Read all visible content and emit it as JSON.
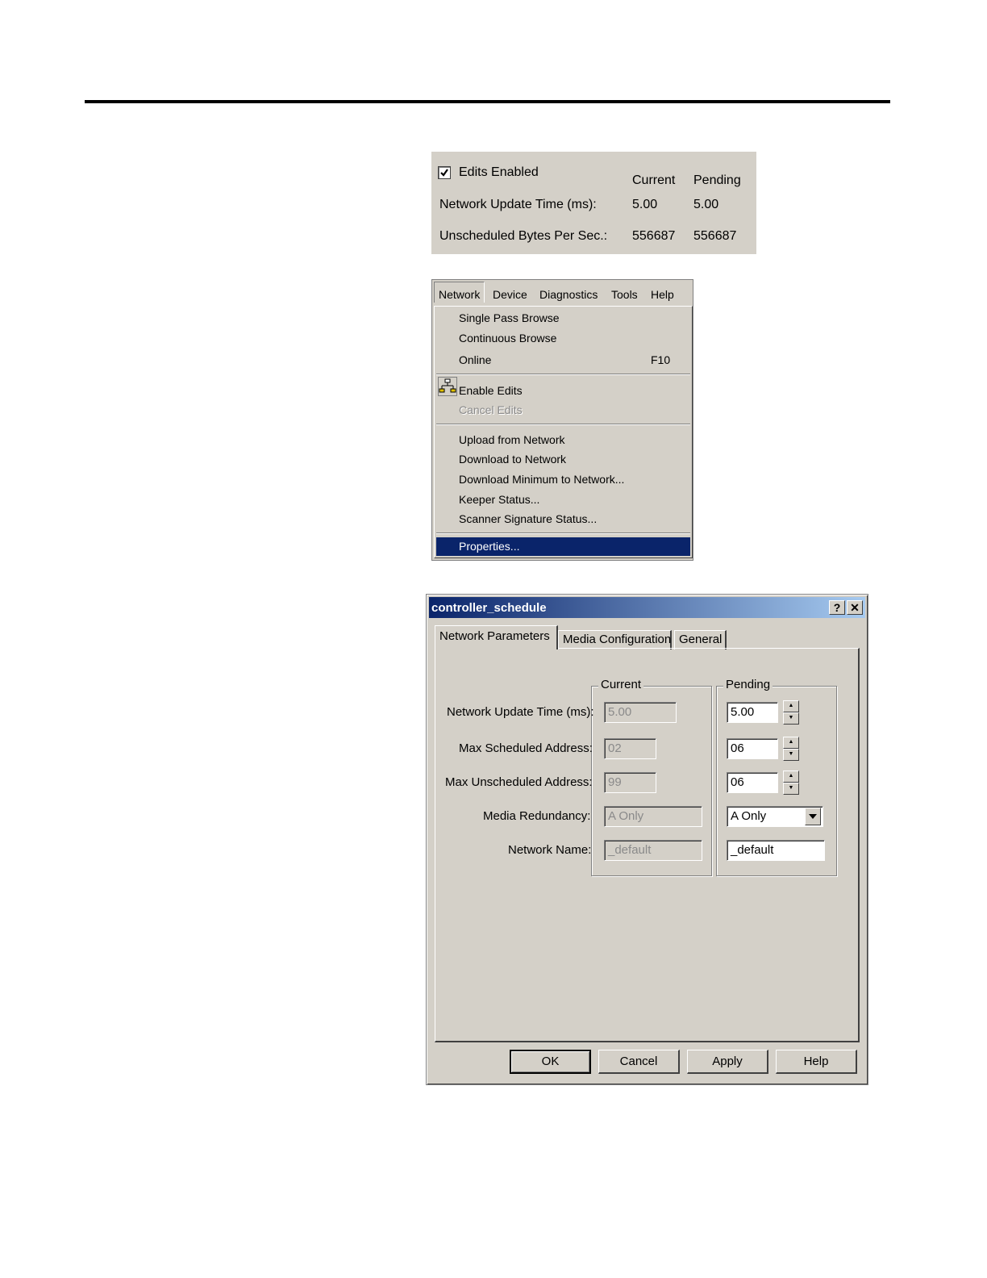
{
  "status_panel": {
    "edits_enabled_label": "Edits Enabled",
    "current_header": "Current",
    "pending_header": "Pending",
    "rows": [
      {
        "label": "Network Update Time (ms):",
        "current": "5.00",
        "pending": "5.00"
      },
      {
        "label": "Unscheduled Bytes Per Sec.:",
        "current": "556687",
        "pending": "556687"
      }
    ]
  },
  "menu": {
    "bar": [
      "Network",
      "Device",
      "Diagnostics",
      "Tools",
      "Help"
    ],
    "items": {
      "single_pass_browse": "Single Pass Browse",
      "continuous_browse": "Continuous Browse",
      "online": "Online",
      "online_shortcut": "F10",
      "enable_edits": "Enable Edits",
      "cancel_edits": "Cancel Edits",
      "upload_from_network": "Upload from Network",
      "download_to_network": "Download to Network",
      "download_minimum": "Download Minimum to Network...",
      "keeper_status": "Keeper Status...",
      "scanner_signature_status": "Scanner Signature Status...",
      "properties": "Properties..."
    },
    "highlight_color": "#0a246a"
  },
  "dialog": {
    "title": "controller_schedule",
    "help_button": "?",
    "close_button": "✕",
    "tabs": [
      "Network Parameters",
      "Media Configuration",
      "General"
    ],
    "current_group": "Current",
    "pending_group": "Pending",
    "fields": {
      "network_update_time": {
        "label": "Network Update Time (ms):",
        "current": "5.00",
        "pending": "5.00"
      },
      "max_scheduled_address": {
        "label": "Max Scheduled Address:",
        "current": "02",
        "pending": "06"
      },
      "max_unscheduled_address": {
        "label": "Max Unscheduled Address:",
        "current": "99",
        "pending": "06"
      },
      "media_redundancy": {
        "label": "Media Redundancy:",
        "current": "A Only",
        "pending": "A Only"
      },
      "network_name": {
        "label": "Network Name:",
        "current": "_default",
        "pending": "_default"
      }
    },
    "buttons": {
      "ok": "OK",
      "cancel": "Cancel",
      "apply": "Apply",
      "help": "Help"
    }
  }
}
